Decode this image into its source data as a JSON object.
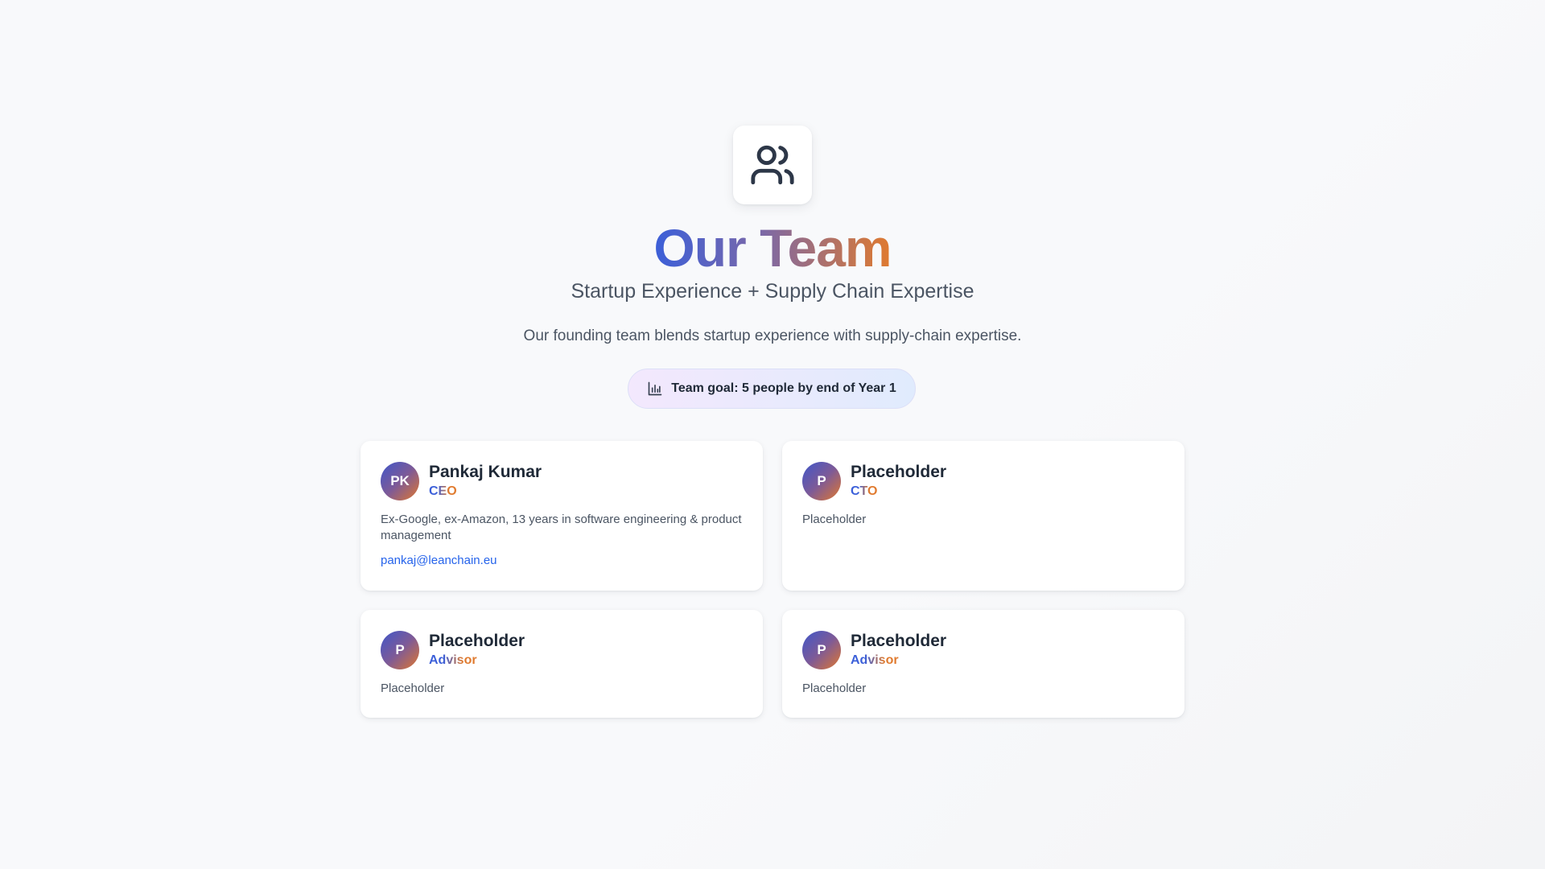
{
  "header": {
    "icon": "users-icon",
    "title": "Our Team",
    "subtitle": "Startup Experience + Supply Chain Expertise",
    "description": "Our founding team blends startup experience with supply-chain expertise.",
    "goal": {
      "icon": "bar-chart-icon",
      "label": "Team goal: 5 people by end of Year 1"
    }
  },
  "colors": {
    "accent_blue": "#3b5fd9",
    "accent_orange": "#e07a2e",
    "link": "#2563eb"
  },
  "members": [
    {
      "initials": "PK",
      "name": "Pankaj Kumar",
      "role": "CEO",
      "bio": "Ex-Google, ex-Amazon, 13 years in software engineering & product management",
      "email": "pankaj@leanchain.eu"
    },
    {
      "initials": "P",
      "name": "Placeholder",
      "role": "CTO",
      "bio": "Placeholder"
    },
    {
      "initials": "P",
      "name": "Placeholder",
      "role": "Advisor",
      "bio": "Placeholder"
    },
    {
      "initials": "P",
      "name": "Placeholder",
      "role": "Advisor",
      "bio": "Placeholder"
    }
  ]
}
